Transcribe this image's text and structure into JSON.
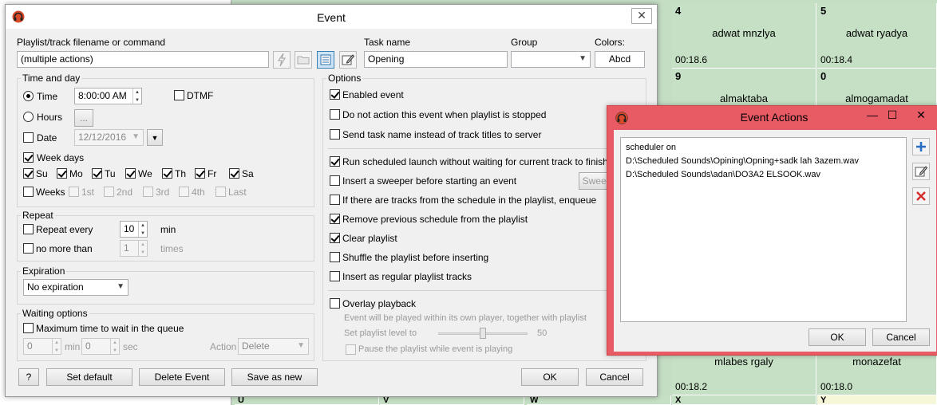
{
  "background": {
    "cells": [
      {
        "num": "4",
        "title": "adwat mnzlya",
        "time": "00:18.6"
      },
      {
        "num": "5",
        "title": "adwat ryadya",
        "time": "00:18.4"
      },
      {
        "num": "9",
        "title": "almaktaba",
        "time": ""
      },
      {
        "num": "0",
        "title": "almogamadat",
        "time": ""
      },
      {
        "num": "",
        "title": "mlabes rgaly",
        "time": "00:18.2"
      },
      {
        "num": "",
        "title": "monazefat",
        "time": "00:18.0"
      },
      {
        "num": "U",
        "title": "",
        "time": ""
      },
      {
        "num": "V",
        "title": "",
        "time": ""
      },
      {
        "num": "W",
        "title": "",
        "time": ""
      },
      {
        "num": "X",
        "title": "",
        "time": ""
      },
      {
        "num": "Y",
        "title": "",
        "time": ""
      }
    ]
  },
  "event_dialog": {
    "title": "Event",
    "close_glyph": "✕",
    "playlist_label": "Playlist/track filename or command",
    "playlist_value": "(multiple actions)",
    "task_name_label": "Task name",
    "task_name_value": "Opening",
    "group_label": "Group",
    "group_value": "",
    "colors_label": "Colors:",
    "colors_value": "Abcd",
    "time_and_day": {
      "title": "Time and day",
      "time_label": "Time",
      "time_value": "8:00:00 AM",
      "dtmf_label": "DTMF",
      "hours_label": "Hours",
      "hours_btn": "...",
      "date_label": "Date",
      "date_value": "12/12/2016",
      "week_days_label": "Week days",
      "days": [
        "Su",
        "Mo",
        "Tu",
        "We",
        "Th",
        "Fr",
        "Sa"
      ],
      "weeks_label": "Weeks",
      "weeks": [
        "1st",
        "2nd",
        "3rd",
        "4th",
        "Last"
      ]
    },
    "repeat": {
      "title": "Repeat",
      "repeat_every_label": "Repeat every",
      "repeat_every_value": "10",
      "repeat_every_unit": "min",
      "no_more_than_label": "no more than",
      "no_more_than_value": "1",
      "no_more_than_unit": "times"
    },
    "expiration": {
      "title": "Expiration",
      "value": "No expiration"
    },
    "waiting": {
      "title": "Waiting options",
      "max_time_label": "Maximum time to wait in the queue",
      "min_value": "0",
      "min_unit": "min",
      "sec_value": "0",
      "sec_unit": "sec",
      "action_label": "Action",
      "action_value": "Delete"
    },
    "options": {
      "title": "Options",
      "enabled_event": "Enabled event",
      "do_not_action": "Do not action this event when playlist is stopped",
      "send_task_name": "Send task name instead of track titles to server",
      "run_scheduled": "Run scheduled launch without waiting for current track to finish",
      "insert_sweeper": "Insert a sweeper before starting an event",
      "sweeper_btn": "Sweep",
      "if_tracks": "If there are tracks from the schedule in the playlist, enqueue",
      "remove_previous": "Remove previous schedule from the playlist",
      "clear_playlist": "Clear playlist",
      "shuffle": "Shuffle the playlist before inserting",
      "insert_regular": "Insert as regular playlist tracks",
      "overlay": "Overlay playback",
      "overlay_desc": "Event will be played within its own player, together with playlist",
      "set_level_label": "Set playlist level to",
      "set_level_value": "50",
      "set_level_fraction": 0.5,
      "pause_label": "Pause the playlist while event is playing"
    },
    "buttons": {
      "help": "?",
      "set_default": "Set default",
      "delete_event": "Delete Event",
      "save_as_new": "Save as new",
      "ok": "OK",
      "cancel": "Cancel"
    }
  },
  "actions_dialog": {
    "title": "Event Actions",
    "minimize_glyph": "—",
    "maximize_glyph": "☐",
    "close_glyph": "✕",
    "items": [
      "scheduler on",
      "D:\\Scheduled Sounds\\Opining\\Opning+sadk lah 3azem.wav",
      "D:\\Scheduled Sounds\\adan\\DO3A2 ELSOOK.wav"
    ],
    "add_glyph": "+",
    "remove_glyph": "✕",
    "ok": "OK",
    "cancel": "Cancel"
  }
}
